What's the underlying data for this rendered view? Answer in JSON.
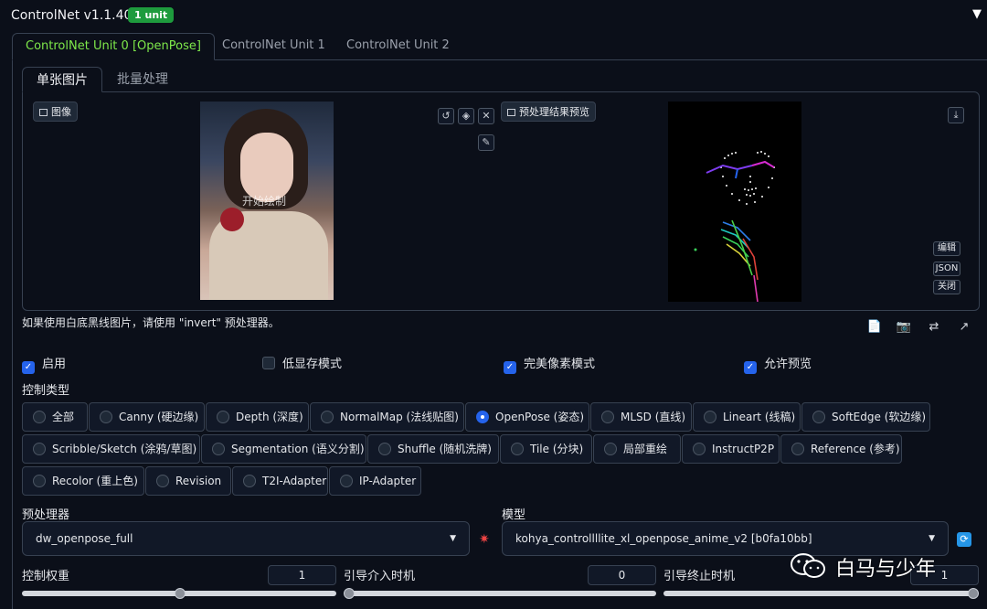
{
  "header": {
    "title": "ControlNet v1.1.405",
    "badge": "1 unit",
    "collapse_icon": "triangle-down-icon"
  },
  "unit_tabs": [
    {
      "label": "ControlNet Unit 0 [OpenPose]",
      "active": true
    },
    {
      "label": "ControlNet Unit 1",
      "active": false
    },
    {
      "label": "ControlNet Unit 2",
      "active": false
    }
  ],
  "sub_tabs": [
    {
      "label": "单张图片",
      "active": true
    },
    {
      "label": "批量处理",
      "active": false
    }
  ],
  "image_panel": {
    "input_label": "图像",
    "input_watermark": "开始绘制",
    "preview_label": "预处理结果预览",
    "tool_icons": [
      "rotate-icon",
      "eraser-icon",
      "close-icon",
      "brush-icon"
    ],
    "side_buttons": [
      "编辑",
      "JSON",
      "关闭"
    ]
  },
  "hint": "如果使用白底黑线图片，请使用 \"invert\" 预处理器。",
  "checkboxes": [
    {
      "label": "启用",
      "checked": true
    },
    {
      "label": "低显存模式",
      "checked": false
    },
    {
      "label": "完美像素模式",
      "checked": true
    },
    {
      "label": "允许预览",
      "checked": true
    }
  ],
  "control_type": {
    "label": "控制类型",
    "options": [
      {
        "label": "全部",
        "selected": false
      },
      {
        "label": "Canny (硬边缘)",
        "selected": false
      },
      {
        "label": "Depth (深度)",
        "selected": false
      },
      {
        "label": "NormalMap (法线贴图)",
        "selected": false
      },
      {
        "label": "OpenPose (姿态)",
        "selected": true
      },
      {
        "label": "MLSD (直线)",
        "selected": false
      },
      {
        "label": "Lineart (线稿)",
        "selected": false
      },
      {
        "label": "SoftEdge (软边缘)",
        "selected": false
      },
      {
        "label": "Scribble/Sketch (涂鸦/草图)",
        "selected": false
      },
      {
        "label": "Segmentation (语义分割)",
        "selected": false
      },
      {
        "label": "Shuffle (随机洗牌)",
        "selected": false
      },
      {
        "label": "Tile (分块)",
        "selected": false
      },
      {
        "label": "局部重绘",
        "selected": false
      },
      {
        "label": "InstructP2P",
        "selected": false
      },
      {
        "label": "Reference (参考)",
        "selected": false
      },
      {
        "label": "Recolor (重上色)",
        "selected": false
      },
      {
        "label": "Revision",
        "selected": false
      },
      {
        "label": "T2I-Adapter",
        "selected": false
      },
      {
        "label": "IP-Adapter",
        "selected": false
      }
    ]
  },
  "preprocessor": {
    "label": "预处理器",
    "value": "dw_openpose_full"
  },
  "model": {
    "label": "模型",
    "value": "kohya_controllllite_xl_openpose_anime_v2 [b0fa10bb]"
  },
  "sliders": [
    {
      "label": "控制权重",
      "value": "1",
      "fraction": 0.5
    },
    {
      "label": "引导介入时机",
      "value": "0",
      "fraction": 0.0
    },
    {
      "label": "引导终止时机",
      "value": "1",
      "fraction": 1.0
    }
  ],
  "watermark": {
    "text": "白马与少年",
    "icon": "wechat-icon"
  }
}
